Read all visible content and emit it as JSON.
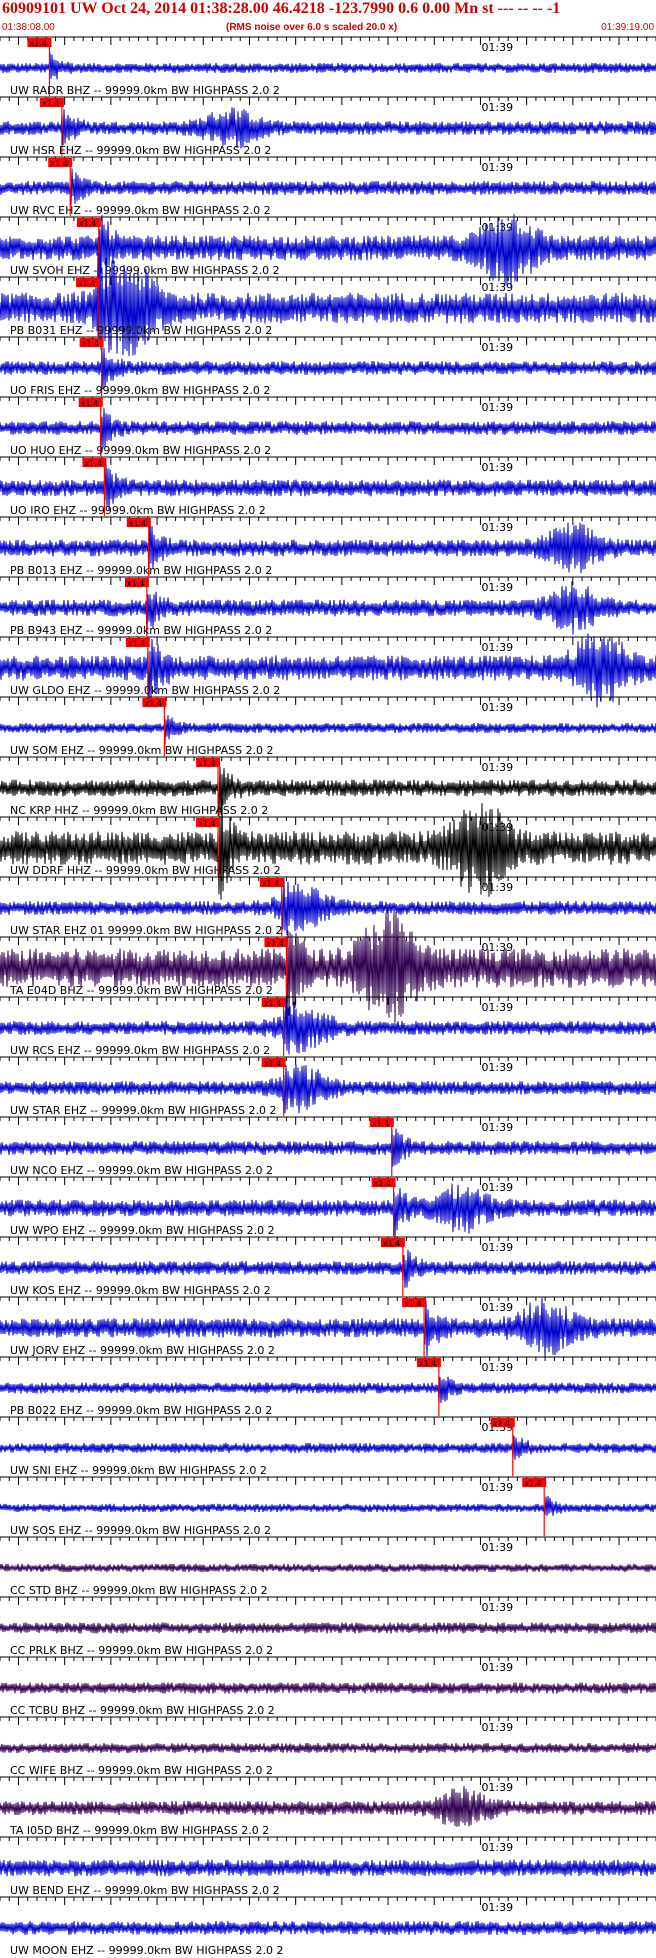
{
  "header": {
    "title": "60909101 UW Oct 24, 2014 01:38:28.00   46.4218 -123.7990  0.6 0.00 Mn st --- -- --   -1",
    "start_time": "01:38:08.00",
    "end_time": "01:39:19.00",
    "note": "(RMS noise over 6.0 s scaled 20.0 x)"
  },
  "chart_data": {
    "type": "line",
    "title": "60909101 UW Oct 24, 2014 01:38:28.00   46.4218 -123.7990  0.6 0.00 Mn st --- -- --   -1",
    "x_range": [
      "01:38:08.00",
      "01:39:19.00"
    ],
    "minute_tick_label": "01:39",
    "pick_label": "x1.4",
    "colors": {
      "trace": "#0000cc",
      "trace_dark": "#000000",
      "trace_purple": "#300050",
      "pick": "#ff0000",
      "axis": "#000000",
      "header_bg": "#e6e6e6"
    },
    "traces": [
      {
        "label": "UW RADR BHZ -- 99999.0km BW  HIGHPASS  2.0  2",
        "pick_time": "01:38:13.35",
        "amp": 0.18,
        "color": "blue",
        "burst": null
      },
      {
        "label": "UW HSR EHZ -- 99999.0km BW  HIGHPASS  2.0  2",
        "pick_time": "01:38:14.70",
        "amp": 0.25,
        "color": "blue",
        "burst": "01:38:33"
      },
      {
        "label": "UW RVC EHZ -- 99999.0km BW  HIGHPASS  2.0  2",
        "pick_time": "01:38:15.60",
        "amp": 0.25,
        "color": "blue",
        "burst": null
      },
      {
        "label": "UW SVOH EHZ -- 99999.0km BW  HIGHPASS  2.0  2",
        "pick_time": "01:38:18.70",
        "amp": 0.45,
        "color": "blue",
        "burst": "01:39:03"
      },
      {
        "label": "PB B031 EHZ -- 99999.0km BW  HIGHPASS  2.0  2",
        "pick_time": "01:38:18.60",
        "amp": 0.55,
        "color": "blue",
        "burst": "01:38:22"
      },
      {
        "label": "UO FRIS EHZ -- 99999.0km BW  HIGHPASS  2.0  2",
        "pick_time": "01:38:19.00",
        "amp": 0.25,
        "color": "blue",
        "burst": null
      },
      {
        "label": "UO HUO EHZ -- 99999.0km BW  HIGHPASS  2.0  2",
        "pick_time": "01:38:18.90",
        "amp": 0.25,
        "color": "blue",
        "burst": null
      },
      {
        "label": "UO IRO EHZ -- 99999.0km BW  HIGHPASS  2.0  2",
        "pick_time": "01:38:19.30",
        "amp": 0.3,
        "color": "blue",
        "burst": null
      },
      {
        "label": "PB B013 EHZ -- 99999.0km BW  HIGHPASS  2.0  2",
        "pick_time": "01:38:24.10",
        "amp": 0.3,
        "color": "blue",
        "burst": "01:39:10"
      },
      {
        "label": "PB B943 EHZ -- 99999.0km BW  HIGHPASS  2.0  2",
        "pick_time": "01:38:23.90",
        "amp": 0.3,
        "color": "blue",
        "burst": "01:39:10"
      },
      {
        "label": "UW GLDO EHZ -- 99999.0km BW  HIGHPASS  2.0  2",
        "pick_time": "01:38:24.00",
        "amp": 0.45,
        "color": "blue",
        "burst": "01:39:13"
      },
      {
        "label": "UW SOM EHZ -- 99999.0km BW  HIGHPASS  2.0  2",
        "pick_time": "01:38:25.80",
        "amp": 0.18,
        "color": "blue",
        "burst": null
      },
      {
        "label": "NC KRP HHZ -- 99999.0km BW  HIGHPASS  2.0  2",
        "pick_time": "01:38:31.60",
        "amp": 0.3,
        "color": "black",
        "burst": null
      },
      {
        "label": "UW DDRF HHZ -- 99999.0km BW  HIGHPASS  2.0  2",
        "pick_time": "01:38:31.60",
        "amp": 0.6,
        "color": "black",
        "burst": "01:39:00"
      },
      {
        "label": "UW STAR EHZ 01 99999.0km BW  HIGHPASS  2.0  2",
        "pick_time": "01:38:38.50",
        "amp": 0.25,
        "color": "blue",
        "burst": "01:38:41"
      },
      {
        "label": "TA E04D BHZ -- 99999.0km BW  HIGHPASS  2.0  2",
        "pick_time": "01:38:39.00",
        "amp": 0.7,
        "color": "purple",
        "burst": "01:38:50"
      },
      {
        "label": "UW RCS EHZ -- 99999.0km BW  HIGHPASS  2.0  2",
        "pick_time": "01:38:38.70",
        "amp": 0.25,
        "color": "blue",
        "burst": "01:38:41"
      },
      {
        "label": "UW STAR EHZ -- 99999.0km BW  HIGHPASS  2.0  2",
        "pick_time": "01:38:38.70",
        "amp": 0.25,
        "color": "blue",
        "burst": "01:38:41"
      },
      {
        "label": "UW NCO EHZ -- 99999.0km BW  HIGHPASS  2.0  2",
        "pick_time": "01:38:50.40",
        "amp": 0.25,
        "color": "blue",
        "burst": null
      },
      {
        "label": "UW WPO EHZ -- 99999.0km BW  HIGHPASS  2.0  2",
        "pick_time": "01:38:50.60",
        "amp": 0.3,
        "color": "blue",
        "burst": "01:38:58"
      },
      {
        "label": "UW KOS EHZ -- 99999.0km BW  HIGHPASS  2.0  2",
        "pick_time": "01:38:51.60",
        "amp": 0.25,
        "color": "blue",
        "burst": null
      },
      {
        "label": "UW JORV EHZ -- 99999.0km BW  HIGHPASS  2.0  2",
        "pick_time": "01:38:53.90",
        "amp": 0.35,
        "color": "blue",
        "burst": "01:39:07"
      },
      {
        "label": "PB B022 EHZ -- 99999.0km BW  HIGHPASS  2.0  2",
        "pick_time": "01:38:55.50",
        "amp": 0.2,
        "color": "blue",
        "burst": null
      },
      {
        "label": "UW SNI EHZ -- 99999.0km BW  HIGHPASS  2.0  2",
        "pick_time": "01:39:03.50",
        "amp": 0.18,
        "color": "blue",
        "burst": null
      },
      {
        "label": "UW SOS EHZ -- 99999.0km BW  HIGHPASS  2.0  2",
        "pick_time": "01:39:06.90",
        "amp": 0.15,
        "color": "blue",
        "burst": null
      },
      {
        "label": "CC STD BHZ -- 99999.0km BW  HIGHPASS  2.0  2",
        "pick_time": null,
        "amp": 0.15,
        "color": "purple",
        "burst": null
      },
      {
        "label": "CC PRLK BHZ -- 99999.0km BW  HIGHPASS  2.0  2",
        "pick_time": null,
        "amp": 0.2,
        "color": "purple",
        "burst": null
      },
      {
        "label": "CC TCBU BHZ -- 99999.0km BW  HIGHPASS  2.0  2",
        "pick_time": null,
        "amp": 0.2,
        "color": "purple",
        "burst": null
      },
      {
        "label": "CC WIFE BHZ -- 99999.0km BW  HIGHPASS  2.0  2",
        "pick_time": null,
        "amp": 0.18,
        "color": "purple",
        "burst": null
      },
      {
        "label": "TA I05D BHZ -- 99999.0km BW  HIGHPASS  2.0  2",
        "pick_time": null,
        "amp": 0.25,
        "color": "purple",
        "burst": "01:38:58"
      },
      {
        "label": "UW BEND EHZ -- 99999.0km BW  HIGHPASS  2.0  2",
        "pick_time": null,
        "amp": 0.3,
        "color": "blue",
        "burst": null
      },
      {
        "label": "UW MOON EHZ -- 99999.0km BW  HIGHPASS  2.0  2",
        "pick_time": null,
        "amp": 0.25,
        "color": "blue",
        "burst": null
      }
    ]
  }
}
